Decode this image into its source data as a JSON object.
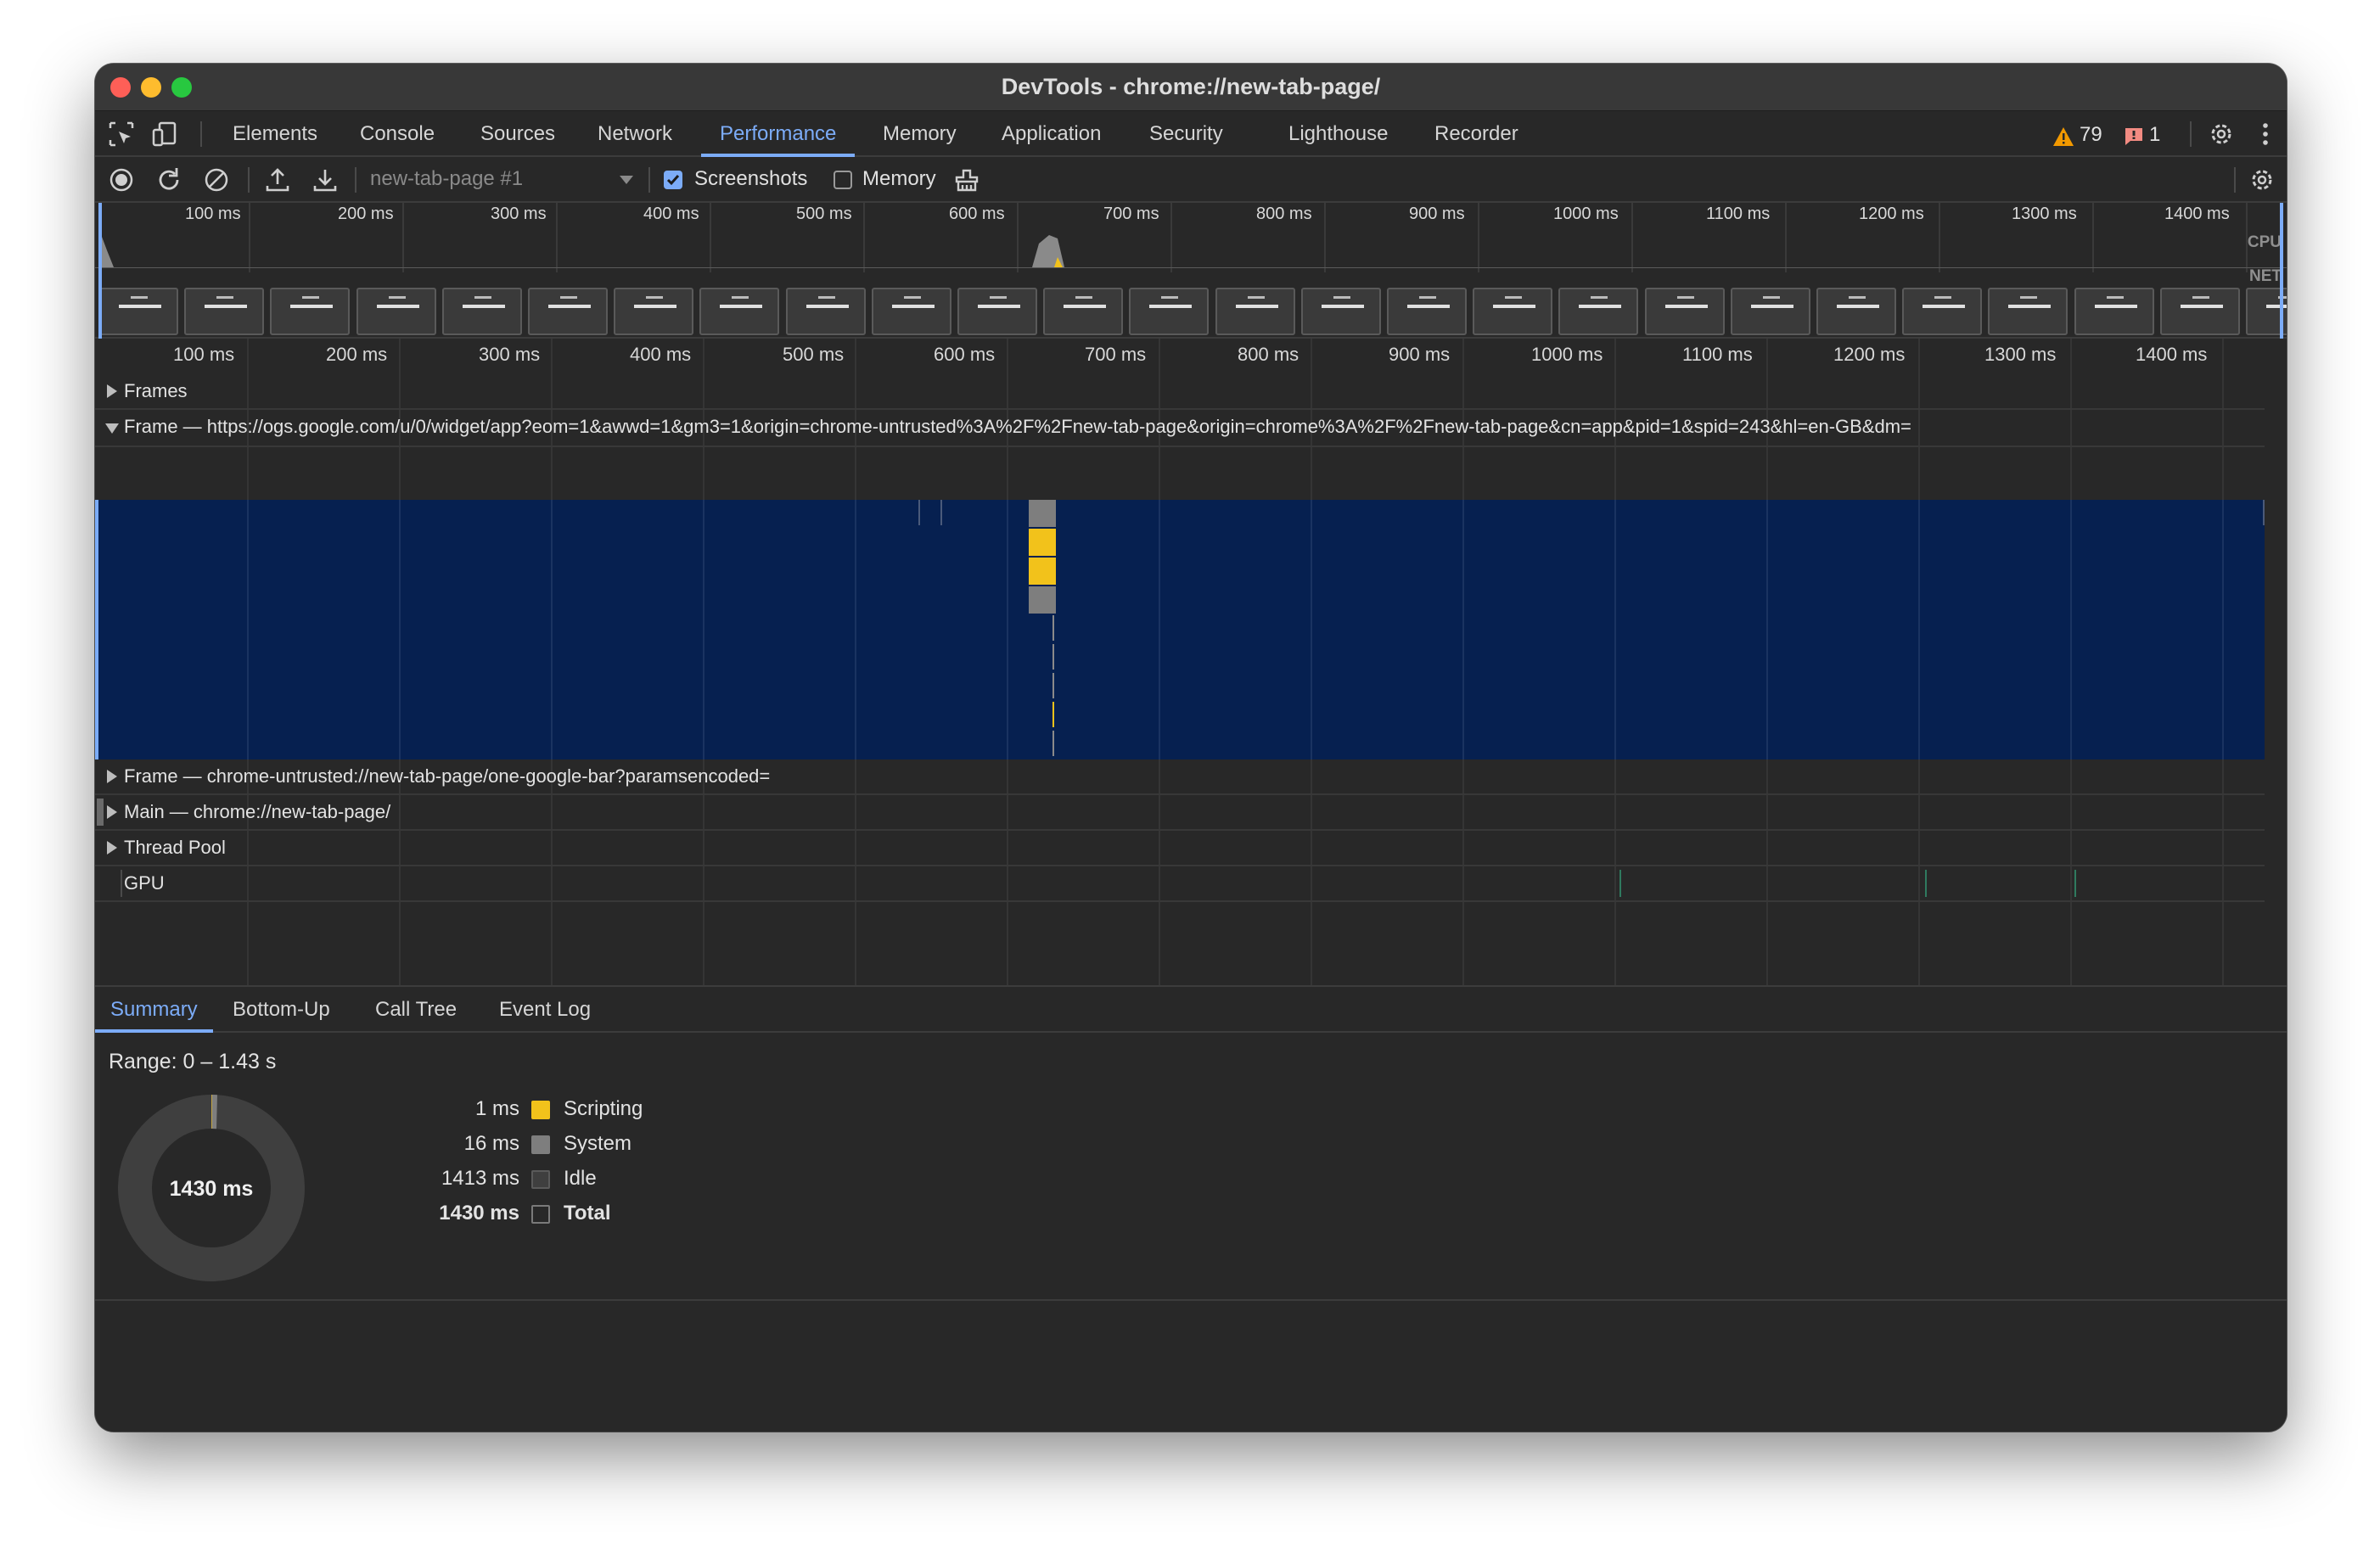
{
  "window": {
    "title": "DevTools - chrome://new-tab-page/"
  },
  "tabs": [
    {
      "label": "Elements"
    },
    {
      "label": "Console"
    },
    {
      "label": "Sources"
    },
    {
      "label": "Network"
    },
    {
      "label": "Performance",
      "active": true
    },
    {
      "label": "Memory"
    },
    {
      "label": "Application"
    },
    {
      "label": "Security"
    },
    {
      "label": "Lighthouse"
    },
    {
      "label": "Recorder"
    }
  ],
  "issues": {
    "warnings": "79",
    "errors": "1"
  },
  "toolbar": {
    "profile_select": "new-tab-page #1",
    "screenshots_label": "Screenshots",
    "screenshots_checked": true,
    "memory_label": "Memory",
    "memory_checked": false
  },
  "overview": {
    "ticks": [
      "100 ms",
      "200 ms",
      "300 ms",
      "400 ms",
      "500 ms",
      "600 ms",
      "700 ms",
      "800 ms",
      "900 ms",
      "1000 ms",
      "1100 ms",
      "1200 ms",
      "1300 ms",
      "1400 ms"
    ],
    "cpu_label": "CPU",
    "net_label": "NET"
  },
  "timeline": {
    "ticks": [
      "100 ms",
      "200 ms",
      "300 ms",
      "400 ms",
      "500 ms",
      "600 ms",
      "700 ms",
      "800 ms",
      "900 ms",
      "1000 ms",
      "1100 ms",
      "1200 ms",
      "1300 ms",
      "1400 ms"
    ],
    "tracks": {
      "frames": "Frames",
      "frame_ogs": "Frame — https://ogs.google.com/u/0/widget/app?eom=1&awwd=1&gm3=1&origin=chrome-untrusted%3A%2F%2Fnew-tab-page&origin=chrome%3A%2F%2Fnew-tab-page&cn=app&pid=1&spid=243&hl=en-GB&dm=",
      "frame_bar": "Frame — chrome-untrusted://new-tab-page/one-google-bar?paramsencoded=",
      "main": "Main — chrome://new-tab-page/",
      "thread_pool": "Thread Pool",
      "gpu": "GPU"
    }
  },
  "summary": {
    "tabs": [
      "Summary",
      "Bottom-Up",
      "Call Tree",
      "Event Log"
    ],
    "range": "Range: 0 – 1.43 s",
    "total_center": "1430 ms",
    "legend": [
      {
        "value": "1 ms",
        "name": "Scripting",
        "color": "#f2c21b"
      },
      {
        "value": "16 ms",
        "name": "System",
        "color": "#7e7e7e"
      },
      {
        "value": "1413 ms",
        "name": "Idle",
        "color": "#3f3f3f"
      },
      {
        "value": "1430 ms",
        "name": "Total",
        "color": "#282828"
      }
    ]
  },
  "colors": {
    "accent": "#7cacf8",
    "scripting": "#f2c21b",
    "system": "#7e7e7e",
    "frame_background": "#062050"
  }
}
